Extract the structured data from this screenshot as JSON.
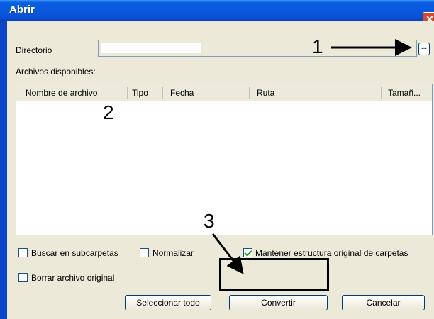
{
  "window": {
    "title": "Abrir",
    "close_glyph": "✕"
  },
  "directory": {
    "label": "Directorio",
    "value": "",
    "browse_label": "..."
  },
  "files": {
    "label": "Archivos disponibles:",
    "columns": [
      "Nombre de archivo",
      "Tipo",
      "Fecha",
      "Ruta",
      "Tamañ..."
    ],
    "rows": []
  },
  "options": {
    "subfolders": {
      "label": "Buscar en subcarpetas",
      "checked": false
    },
    "normalize": {
      "label": "Normalizar",
      "checked": false
    },
    "keep_structure": {
      "label": "Mantener estructura original de carpetas",
      "checked": true
    },
    "delete_original": {
      "label": "Borrar archivo original",
      "checked": false
    }
  },
  "buttons": {
    "select_all": "Seleccionar todo",
    "convert": "Convertir",
    "cancel": "Cancelar"
  },
  "annotations": {
    "one": "1",
    "two": "2",
    "three": "3"
  },
  "colors": {
    "title_bar": "#0a58de",
    "dialog_bg": "#ece9d8",
    "accent_border": "#003c74"
  }
}
